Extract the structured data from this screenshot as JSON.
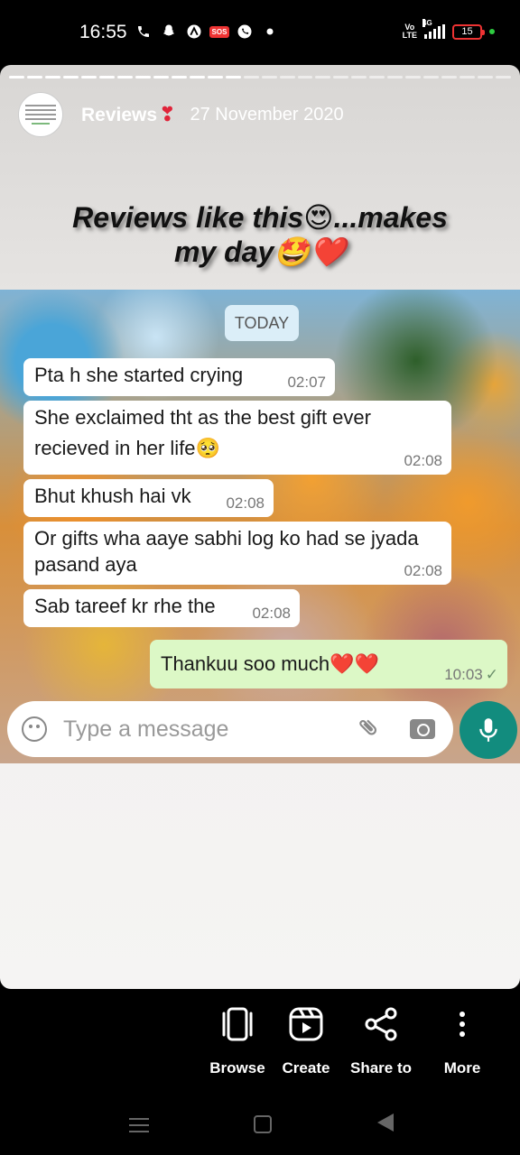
{
  "status_bar": {
    "time": "16:55",
    "network": "4G",
    "battery": "15"
  },
  "story": {
    "user": "Reviews",
    "date": "27 November 2020",
    "caption_line1": "Reviews like this😍...makes",
    "caption_line2": "my day🤩❤️",
    "progress_total": 28,
    "progress_done": 13
  },
  "chat": {
    "day_label": "TODAY",
    "messages": [
      {
        "text": "Pta h she started crying",
        "time": "02:07",
        "direction": "in"
      },
      {
        "text": "She exclaimed tht as the best gift ever recieved in her life🥺",
        "time": "02:08",
        "direction": "in"
      },
      {
        "text": "Bhut khush hai vk",
        "time": "02:08",
        "direction": "in"
      },
      {
        "text": "Or gifts wha aaye sabhi log ko had se jyada pasand aya",
        "time": "02:08",
        "direction": "in"
      },
      {
        "text": "Sab tareef kr rhe the",
        "time": "02:08",
        "direction": "in"
      },
      {
        "text": "Thankuu soo much❤️❤️",
        "time": "10:03",
        "direction": "out"
      }
    ],
    "input_placeholder": "Type a message"
  },
  "actions": {
    "browse": "Browse",
    "create": "Create",
    "share": "Share to",
    "more": "More"
  },
  "colors": {
    "incoming_bubble": "#ffffff",
    "outgoing_bubble": "#dcf8c6",
    "mic_button": "#128c7e",
    "heart": "#e0243a"
  }
}
